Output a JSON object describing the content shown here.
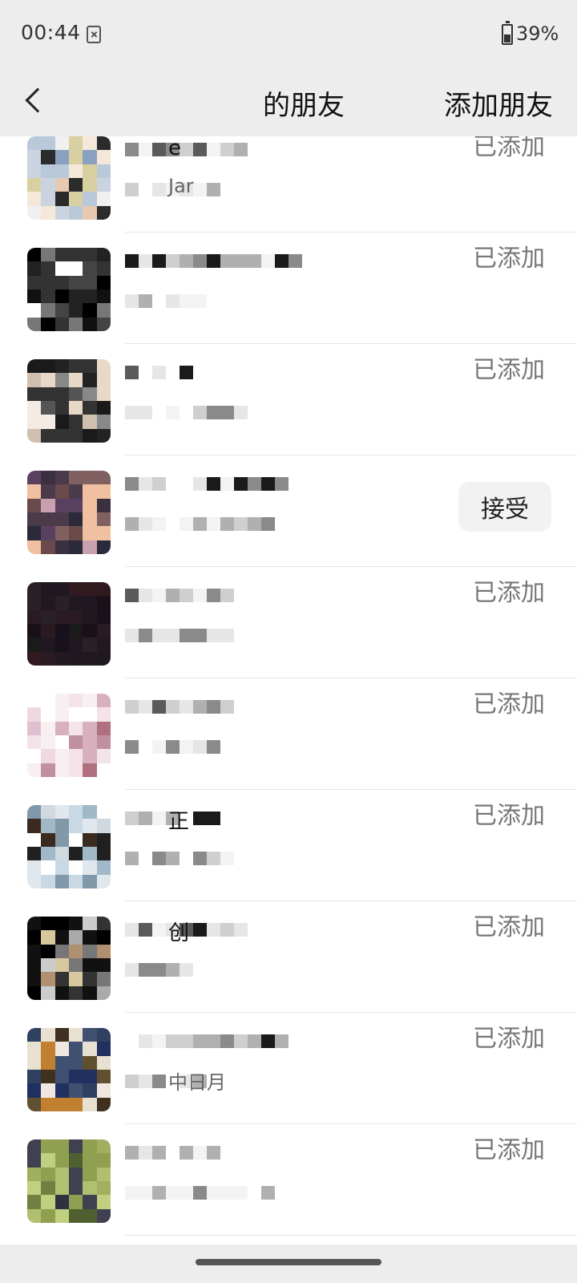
{
  "status_bar": {
    "time": "00:44",
    "battery": "39%",
    "icons": [
      "sim-card-icon",
      "battery-icon"
    ]
  },
  "nav": {
    "title": "的朋友",
    "add_friend": "添加朋友",
    "back_icon": "chevron-left-icon"
  },
  "contacts": [
    {
      "status": "已添加",
      "name_fragment": "e",
      "sub_fragment": "Jar",
      "action": "added"
    },
    {
      "status": "已添加",
      "action": "added"
    },
    {
      "status": "已添加",
      "action": "added"
    },
    {
      "status": "接受",
      "action": "accept"
    },
    {
      "status": "已添加",
      "action": "added"
    },
    {
      "status": "已添加",
      "action": "added"
    },
    {
      "status": "已添加",
      "name_fragment": "正",
      "action": "added"
    },
    {
      "status": "已添加",
      "name_fragment": "创",
      "action": "added"
    },
    {
      "status": "已添加",
      "sub_fragment": "中日月",
      "action": "added"
    },
    {
      "status": "已添加",
      "action": "added"
    }
  ],
  "colors": {
    "header_bg": "#ededed",
    "status_gray": "#777777",
    "accept_bg": "#f2f2f2"
  }
}
